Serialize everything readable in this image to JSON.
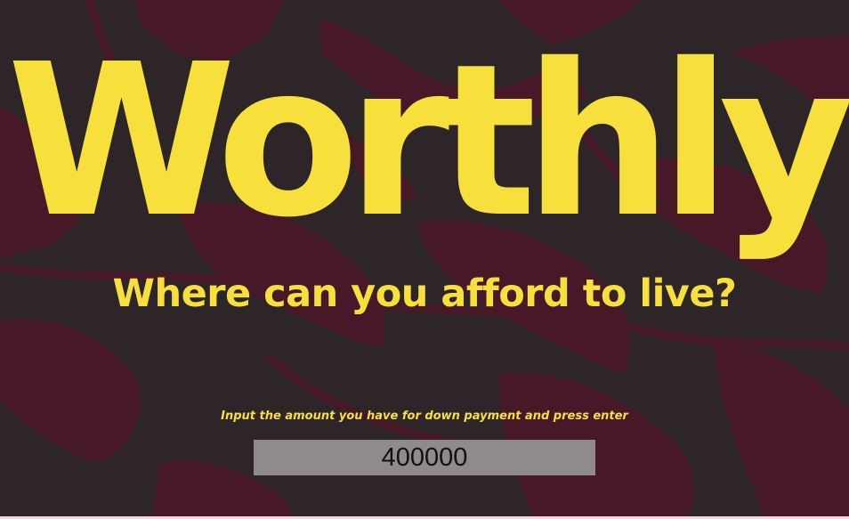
{
  "app": {
    "title": "Worthly",
    "tagline": "Where can you afford to live?"
  },
  "form": {
    "prompt": "Input the amount you have for down payment and press enter",
    "down_payment_value": "400000"
  },
  "colors": {
    "background": "#2e2528",
    "map_water": "#4a1828",
    "accent": "#f7e03c",
    "input_background": "#8f8a8d"
  }
}
